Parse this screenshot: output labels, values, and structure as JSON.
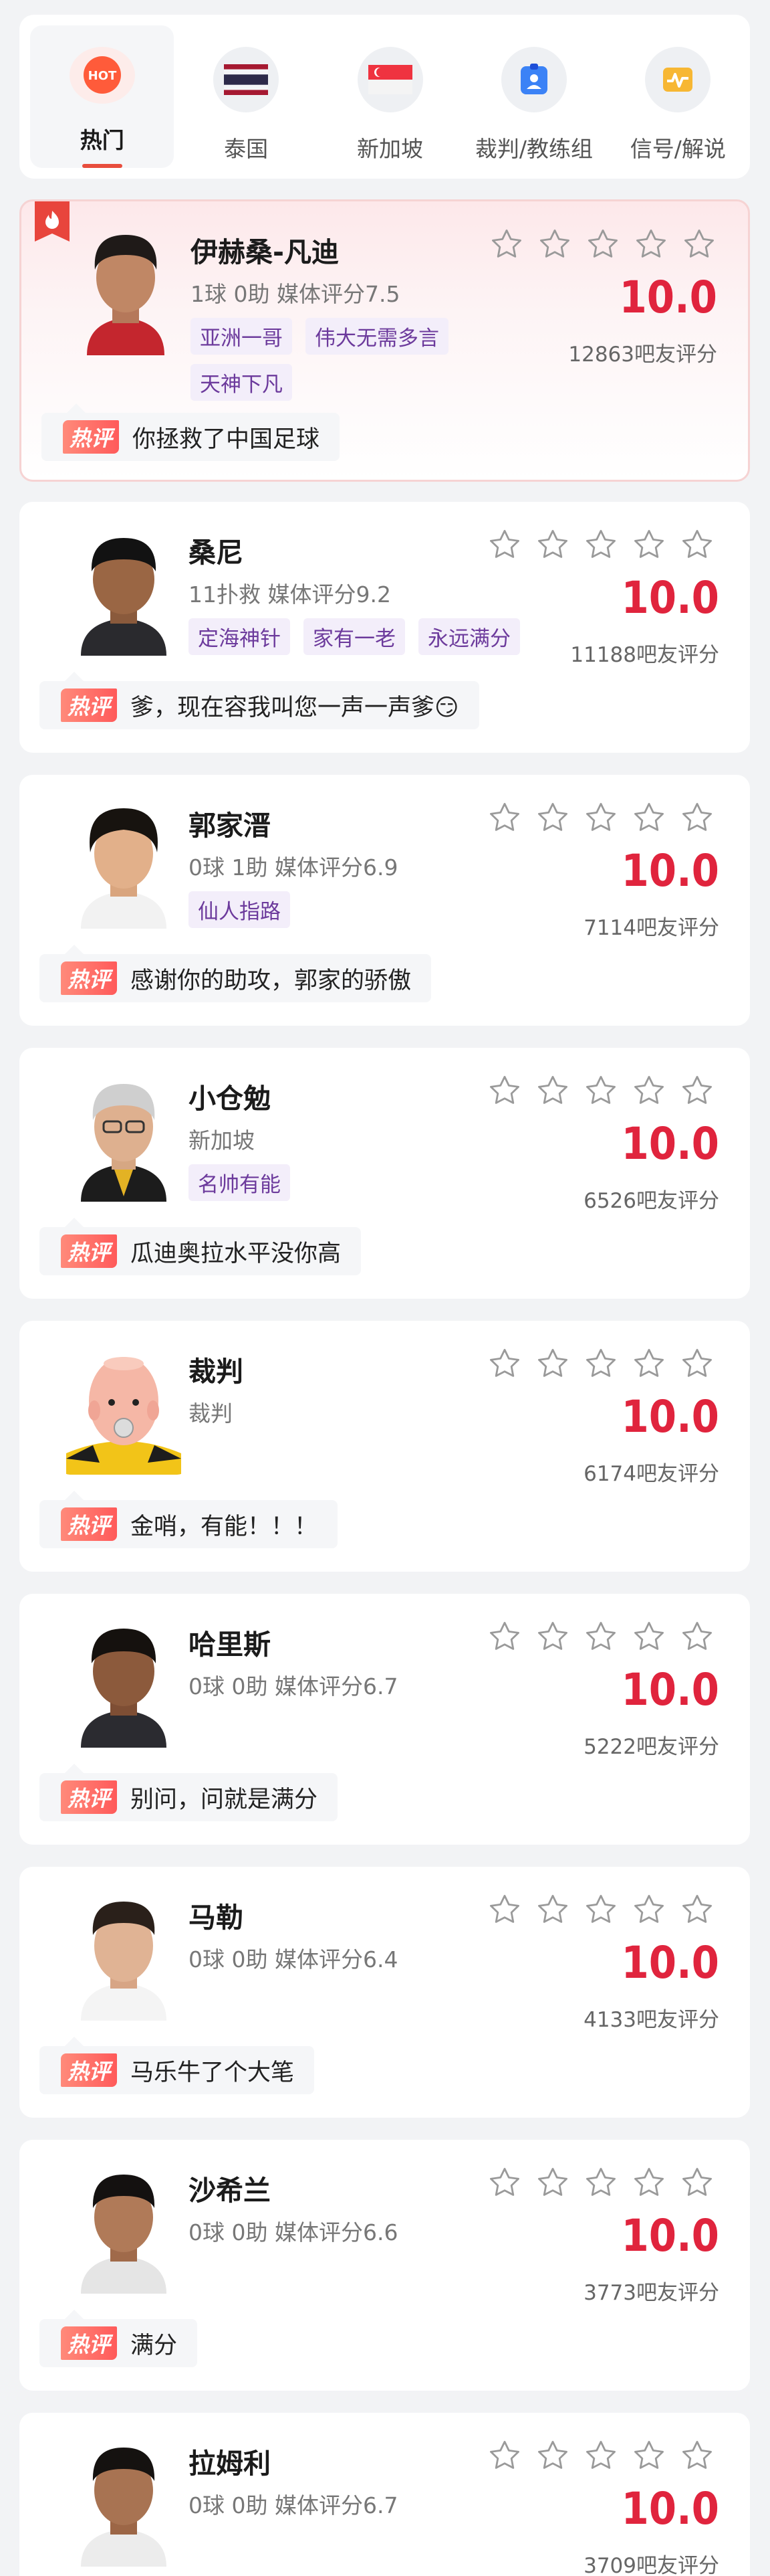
{
  "tabs": [
    {
      "label": "热门",
      "icon": "hot-icon",
      "badge": "HOT",
      "active": true
    },
    {
      "label": "泰国",
      "icon": "thailand-flag-icon",
      "active": false
    },
    {
      "label": "新加坡",
      "icon": "singapore-flag-icon",
      "active": false
    },
    {
      "label": "裁判/教练组",
      "icon": "referee-badge-icon",
      "active": false
    },
    {
      "label": "信号/解说",
      "icon": "signal-icon",
      "active": false
    }
  ],
  "hot_comment_label": "热评",
  "colors": {
    "accent": "#e0243d",
    "tag_text": "#6c3a9c",
    "tag_bg": "#f3eefa"
  },
  "players": [
    {
      "name": "伊赫桑-凡迪",
      "stats": "1球 0助  媒体评分7.5",
      "tags": [
        "亚洲一哥",
        "伟大无需多言",
        "天神下凡"
      ],
      "score": "10.0",
      "voters": "12863吧友评分",
      "comment": "你拯救了中国足球"
    },
    {
      "name": "桑尼",
      "stats": "11扑救  媒体评分9.2",
      "tags": [
        "定海神针",
        "家有一老",
        "永远满分"
      ],
      "score": "10.0",
      "voters": "11188吧友评分",
      "comment": "爹，现在容我叫您一声一声爹😏"
    },
    {
      "name": "郭家溍",
      "stats": "0球 1助  媒体评分6.9",
      "tags": [
        "仙人指路"
      ],
      "score": "10.0",
      "voters": "7114吧友评分",
      "comment": "感谢你的助攻，郭家的骄傲"
    },
    {
      "name": "小仓勉",
      "stats": "新加坡",
      "tags": [
        "名帅有能"
      ],
      "score": "10.0",
      "voters": "6526吧友评分",
      "comment": "瓜迪奥拉水平没你高"
    },
    {
      "name": "裁判",
      "stats": "裁判",
      "tags": [],
      "score": "10.0",
      "voters": "6174吧友评分",
      "comment": "金哨，有能！！！"
    },
    {
      "name": "哈里斯",
      "stats": "0球 0助  媒体评分6.7",
      "tags": [],
      "score": "10.0",
      "voters": "5222吧友评分",
      "comment": "别问，问就是满分"
    },
    {
      "name": "马勒",
      "stats": "0球 0助  媒体评分6.4",
      "tags": [],
      "score": "10.0",
      "voters": "4133吧友评分",
      "comment": "马乐牛了个大笔"
    },
    {
      "name": "沙希兰",
      "stats": "0球 0助  媒体评分6.6",
      "tags": [],
      "score": "10.0",
      "voters": "3773吧友评分",
      "comment": "满分"
    },
    {
      "name": "拉姆利",
      "stats": "0球 0助  媒体评分6.7",
      "tags": [],
      "score": "10.0",
      "voters": "3709吧友评分",
      "comment": ""
    }
  ]
}
